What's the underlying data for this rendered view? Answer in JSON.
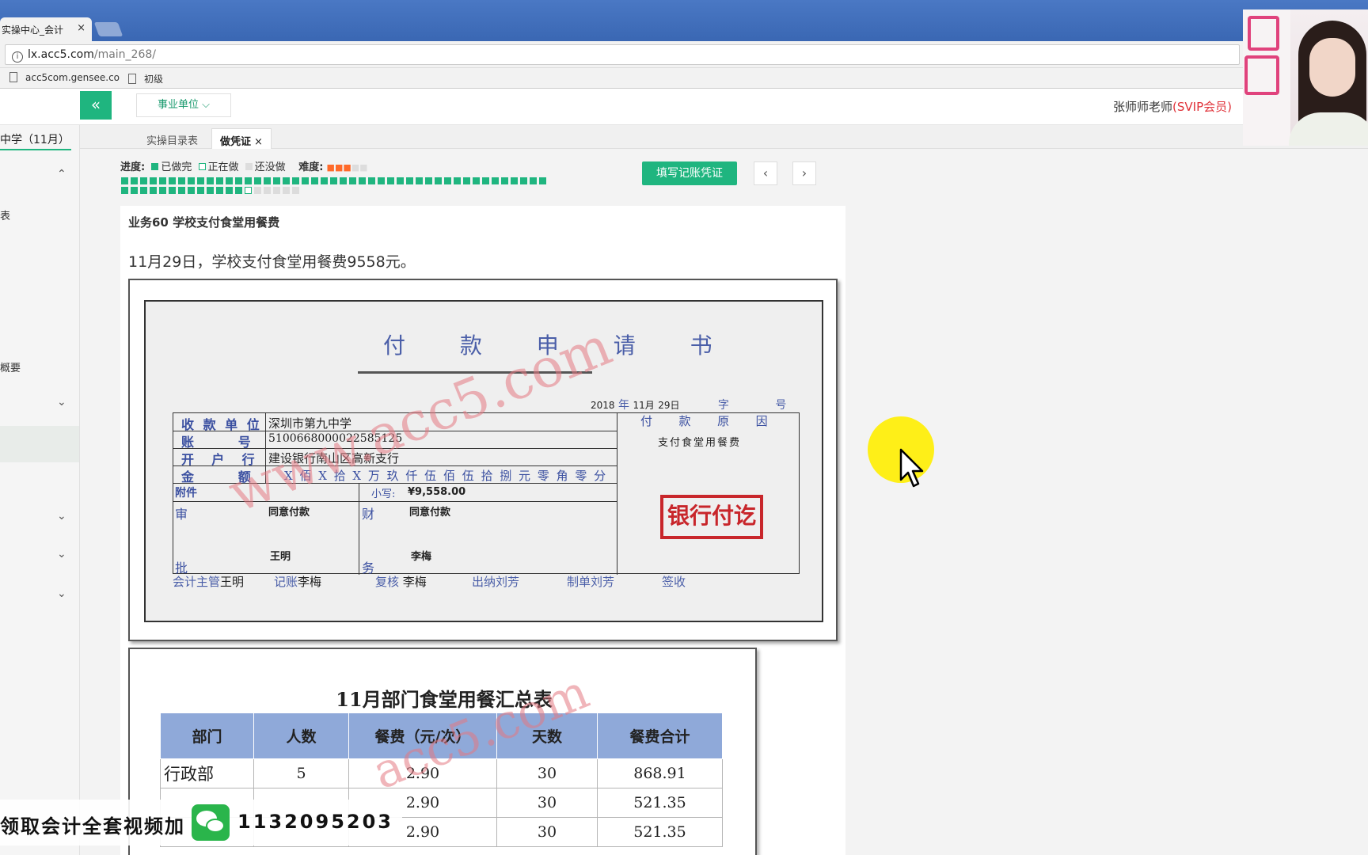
{
  "browser": {
    "tab_title": "实操中心_会计",
    "tab_close": "×",
    "url_host": "lx.acc5.com",
    "url_path": "/main_268/",
    "bookmarks": [
      "acc5com.gensee.co",
      "初级"
    ]
  },
  "header": {
    "collapse_icon": "«",
    "unit_select": "事业单位 ⌵",
    "user_name": "张师师老师",
    "user_badge": "(SVIP会员)"
  },
  "sidebar": {
    "title": "中学（11月）",
    "items": [
      "表",
      "概要"
    ],
    "arrow_up": "⌃",
    "arrow_down": "⌄"
  },
  "tabs": [
    {
      "label": "实操目录表"
    },
    {
      "label": "做凭证",
      "close": "×"
    }
  ],
  "progress": {
    "label": "进度:",
    "done": "已做完",
    "doing": "正在做",
    "todo": "还没做",
    "difficulty_label": "难度:",
    "difficulty": 3,
    "difficulty_max": 5,
    "done_count": 58,
    "current_index": 58,
    "total": 64,
    "colors": {
      "done": "#1fb57f",
      "doing": "#ffffff",
      "todo": "#dcdcdc"
    }
  },
  "actions": {
    "fill_voucher": "填写记账凭证",
    "prev": "‹",
    "next": "›"
  },
  "business": {
    "title": "业务60 学校支付食堂用餐费",
    "description": "11月29日，学校支付食堂用餐费9558元。"
  },
  "voucher": {
    "title": "付 款 申 请 书",
    "date_year": "2018",
    "date_year_unit": "年",
    "date_month": "11月",
    "date_day": "29日",
    "zi": "字",
    "hao": "号",
    "rows": [
      {
        "label": "收 款 单 位",
        "value": "深圳市第九中学"
      },
      {
        "label": "账          号",
        "value": "510066800002258512​5"
      },
      {
        "label": "开    户    行",
        "value": "建设银行南山区高新支行"
      },
      {
        "label": "金          额",
        "value": "X 佰 X 拾 X 万 玖 仟 伍 佰 伍 拾 捌 元 零 角 零 分"
      }
    ],
    "attachment_label": "附件",
    "small_label": "小写:",
    "small_amount": "¥9,558.00",
    "reason_label": "付  款  原  因",
    "reason": "支付食堂用餐费",
    "approve_label_1": "审",
    "approve_label_2": "批",
    "approve_text": "同意付款",
    "approver": "王明",
    "finance_label_1": "财",
    "finance_label_2": "务",
    "finance_text": "同意付款",
    "finance_person": "李梅",
    "stamp": "银行付讫",
    "signatures": [
      {
        "role": "会计主管",
        "name": "王明"
      },
      {
        "role": "记账",
        "name": "李梅"
      },
      {
        "role": "复核",
        "name": "李梅"
      },
      {
        "role": "出纳",
        "name": "刘芳"
      },
      {
        "role": "制单",
        "name": "刘芳"
      },
      {
        "role": "签收",
        "name": ""
      }
    ],
    "watermark": "www.acc5.com"
  },
  "summary": {
    "title": "11月部门食堂用餐汇总表",
    "columns": [
      "部门",
      "人数",
      "餐费（元/次）",
      "天数",
      "餐费合计"
    ],
    "rows": [
      [
        "行政部",
        "5",
        "2.90",
        "30",
        "868.91"
      ],
      [
        "",
        "",
        "2.90",
        "30",
        "521.35"
      ],
      [
        "",
        "",
        "2.90",
        "30",
        "521.35"
      ]
    ],
    "watermark": "acc5.com"
  },
  "promo": {
    "text": "领取会计全套视频加",
    "number": "1132095203"
  }
}
